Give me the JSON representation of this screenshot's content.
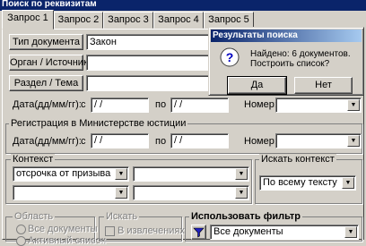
{
  "window_title": "Поиск по реквизитам",
  "tabs": [
    "Запрос 1",
    "Запрос 2",
    "Запрос 3",
    "Запрос 4",
    "Запрос 5"
  ],
  "rows": {
    "doc_type": {
      "button": "Тип документа",
      "value": "Закон"
    },
    "organ": {
      "button": "Орган / Источник",
      "value": ""
    },
    "section": {
      "button": "Раздел / Тема",
      "value": ""
    }
  },
  "date": {
    "label": "Дата(дд/мм/гг):",
    "from_label": "с",
    "from_value": "/ /",
    "to_label": "по",
    "to_value": "/ /",
    "number_label": "Номер:"
  },
  "registration": {
    "group_label": "Регистрация в Министерстве юстиции",
    "date_label": "Дата(дд/мм/гг):",
    "from_label": "с",
    "from_value": "/ /",
    "to_label": "по",
    "to_value": "/ /",
    "number_label": "Номер:"
  },
  "context": {
    "group_label": "Контекст",
    "field1": "отсрочка от призыва",
    "field2": "",
    "field3": "",
    "field4": ""
  },
  "search_context": {
    "group_label": "Искать контекст",
    "value": "По всему тексту"
  },
  "area": {
    "group_label": "Область",
    "option1": "Все документы",
    "option2": "Активный список"
  },
  "search_in": {
    "group_label": "Искать",
    "checkbox_label": "В извлечениях"
  },
  "filter": {
    "group_label": "Использовать фильтр",
    "value": "Все документы"
  },
  "dialog": {
    "title": "Результаты поиска",
    "message_line1": "Найдено: 6 документов.",
    "message_line2": "Построить список?",
    "yes": "Да",
    "no": "Нет"
  },
  "icons": {
    "arrow": "double-arrow-icon",
    "clear": "clear-x-icon",
    "question": "question-icon",
    "filter": "funnel-icon"
  }
}
